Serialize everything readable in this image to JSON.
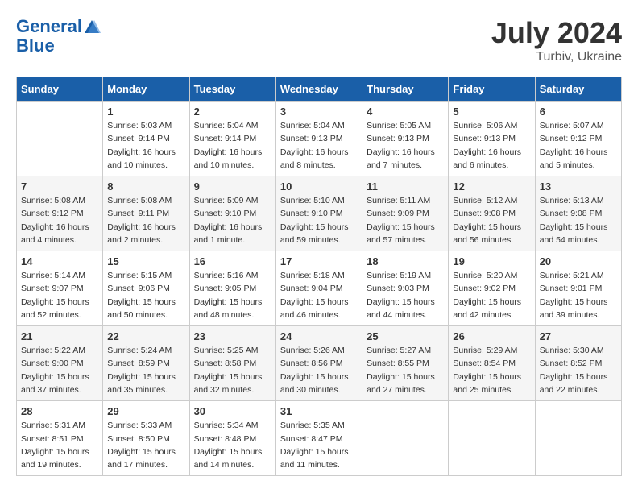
{
  "header": {
    "logo_line1": "General",
    "logo_line2": "Blue",
    "month_year": "July 2024",
    "location": "Turbiv, Ukraine"
  },
  "weekdays": [
    "Sunday",
    "Monday",
    "Tuesday",
    "Wednesday",
    "Thursday",
    "Friday",
    "Saturday"
  ],
  "weeks": [
    [
      {
        "day": "",
        "info": ""
      },
      {
        "day": "1",
        "info": "Sunrise: 5:03 AM\nSunset: 9:14 PM\nDaylight: 16 hours\nand 10 minutes."
      },
      {
        "day": "2",
        "info": "Sunrise: 5:04 AM\nSunset: 9:14 PM\nDaylight: 16 hours\nand 10 minutes."
      },
      {
        "day": "3",
        "info": "Sunrise: 5:04 AM\nSunset: 9:13 PM\nDaylight: 16 hours\nand 8 minutes."
      },
      {
        "day": "4",
        "info": "Sunrise: 5:05 AM\nSunset: 9:13 PM\nDaylight: 16 hours\nand 7 minutes."
      },
      {
        "day": "5",
        "info": "Sunrise: 5:06 AM\nSunset: 9:13 PM\nDaylight: 16 hours\nand 6 minutes."
      },
      {
        "day": "6",
        "info": "Sunrise: 5:07 AM\nSunset: 9:12 PM\nDaylight: 16 hours\nand 5 minutes."
      }
    ],
    [
      {
        "day": "7",
        "info": "Sunrise: 5:08 AM\nSunset: 9:12 PM\nDaylight: 16 hours\nand 4 minutes."
      },
      {
        "day": "8",
        "info": "Sunrise: 5:08 AM\nSunset: 9:11 PM\nDaylight: 16 hours\nand 2 minutes."
      },
      {
        "day": "9",
        "info": "Sunrise: 5:09 AM\nSunset: 9:10 PM\nDaylight: 16 hours\nand 1 minute."
      },
      {
        "day": "10",
        "info": "Sunrise: 5:10 AM\nSunset: 9:10 PM\nDaylight: 15 hours\nand 59 minutes."
      },
      {
        "day": "11",
        "info": "Sunrise: 5:11 AM\nSunset: 9:09 PM\nDaylight: 15 hours\nand 57 minutes."
      },
      {
        "day": "12",
        "info": "Sunrise: 5:12 AM\nSunset: 9:08 PM\nDaylight: 15 hours\nand 56 minutes."
      },
      {
        "day": "13",
        "info": "Sunrise: 5:13 AM\nSunset: 9:08 PM\nDaylight: 15 hours\nand 54 minutes."
      }
    ],
    [
      {
        "day": "14",
        "info": "Sunrise: 5:14 AM\nSunset: 9:07 PM\nDaylight: 15 hours\nand 52 minutes."
      },
      {
        "day": "15",
        "info": "Sunrise: 5:15 AM\nSunset: 9:06 PM\nDaylight: 15 hours\nand 50 minutes."
      },
      {
        "day": "16",
        "info": "Sunrise: 5:16 AM\nSunset: 9:05 PM\nDaylight: 15 hours\nand 48 minutes."
      },
      {
        "day": "17",
        "info": "Sunrise: 5:18 AM\nSunset: 9:04 PM\nDaylight: 15 hours\nand 46 minutes."
      },
      {
        "day": "18",
        "info": "Sunrise: 5:19 AM\nSunset: 9:03 PM\nDaylight: 15 hours\nand 44 minutes."
      },
      {
        "day": "19",
        "info": "Sunrise: 5:20 AM\nSunset: 9:02 PM\nDaylight: 15 hours\nand 42 minutes."
      },
      {
        "day": "20",
        "info": "Sunrise: 5:21 AM\nSunset: 9:01 PM\nDaylight: 15 hours\nand 39 minutes."
      }
    ],
    [
      {
        "day": "21",
        "info": "Sunrise: 5:22 AM\nSunset: 9:00 PM\nDaylight: 15 hours\nand 37 minutes."
      },
      {
        "day": "22",
        "info": "Sunrise: 5:24 AM\nSunset: 8:59 PM\nDaylight: 15 hours\nand 35 minutes."
      },
      {
        "day": "23",
        "info": "Sunrise: 5:25 AM\nSunset: 8:58 PM\nDaylight: 15 hours\nand 32 minutes."
      },
      {
        "day": "24",
        "info": "Sunrise: 5:26 AM\nSunset: 8:56 PM\nDaylight: 15 hours\nand 30 minutes."
      },
      {
        "day": "25",
        "info": "Sunrise: 5:27 AM\nSunset: 8:55 PM\nDaylight: 15 hours\nand 27 minutes."
      },
      {
        "day": "26",
        "info": "Sunrise: 5:29 AM\nSunset: 8:54 PM\nDaylight: 15 hours\nand 25 minutes."
      },
      {
        "day": "27",
        "info": "Sunrise: 5:30 AM\nSunset: 8:52 PM\nDaylight: 15 hours\nand 22 minutes."
      }
    ],
    [
      {
        "day": "28",
        "info": "Sunrise: 5:31 AM\nSunset: 8:51 PM\nDaylight: 15 hours\nand 19 minutes."
      },
      {
        "day": "29",
        "info": "Sunrise: 5:33 AM\nSunset: 8:50 PM\nDaylight: 15 hours\nand 17 minutes."
      },
      {
        "day": "30",
        "info": "Sunrise: 5:34 AM\nSunset: 8:48 PM\nDaylight: 15 hours\nand 14 minutes."
      },
      {
        "day": "31",
        "info": "Sunrise: 5:35 AM\nSunset: 8:47 PM\nDaylight: 15 hours\nand 11 minutes."
      },
      {
        "day": "",
        "info": ""
      },
      {
        "day": "",
        "info": ""
      },
      {
        "day": "",
        "info": ""
      }
    ]
  ]
}
